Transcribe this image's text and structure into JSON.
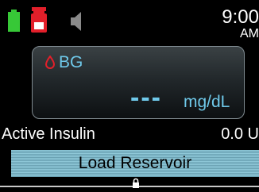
{
  "status": {
    "time": "9:00",
    "ampm": "AM",
    "battery_color": "#37c837",
    "reservoir_color": "#e21f2a",
    "icons": [
      "battery-icon",
      "reservoir-icon",
      "speaker-icon"
    ]
  },
  "bg": {
    "label": "BG",
    "value": "---",
    "unit": "mg/dL",
    "accent_color": "#6fc9ea",
    "drop_color": "#e21f2a"
  },
  "active_insulin": {
    "label": "Active Insulin",
    "value": "0.0 U"
  },
  "action": {
    "label": "Load Reservoir"
  },
  "footer": {
    "icon": "lock-icon"
  }
}
